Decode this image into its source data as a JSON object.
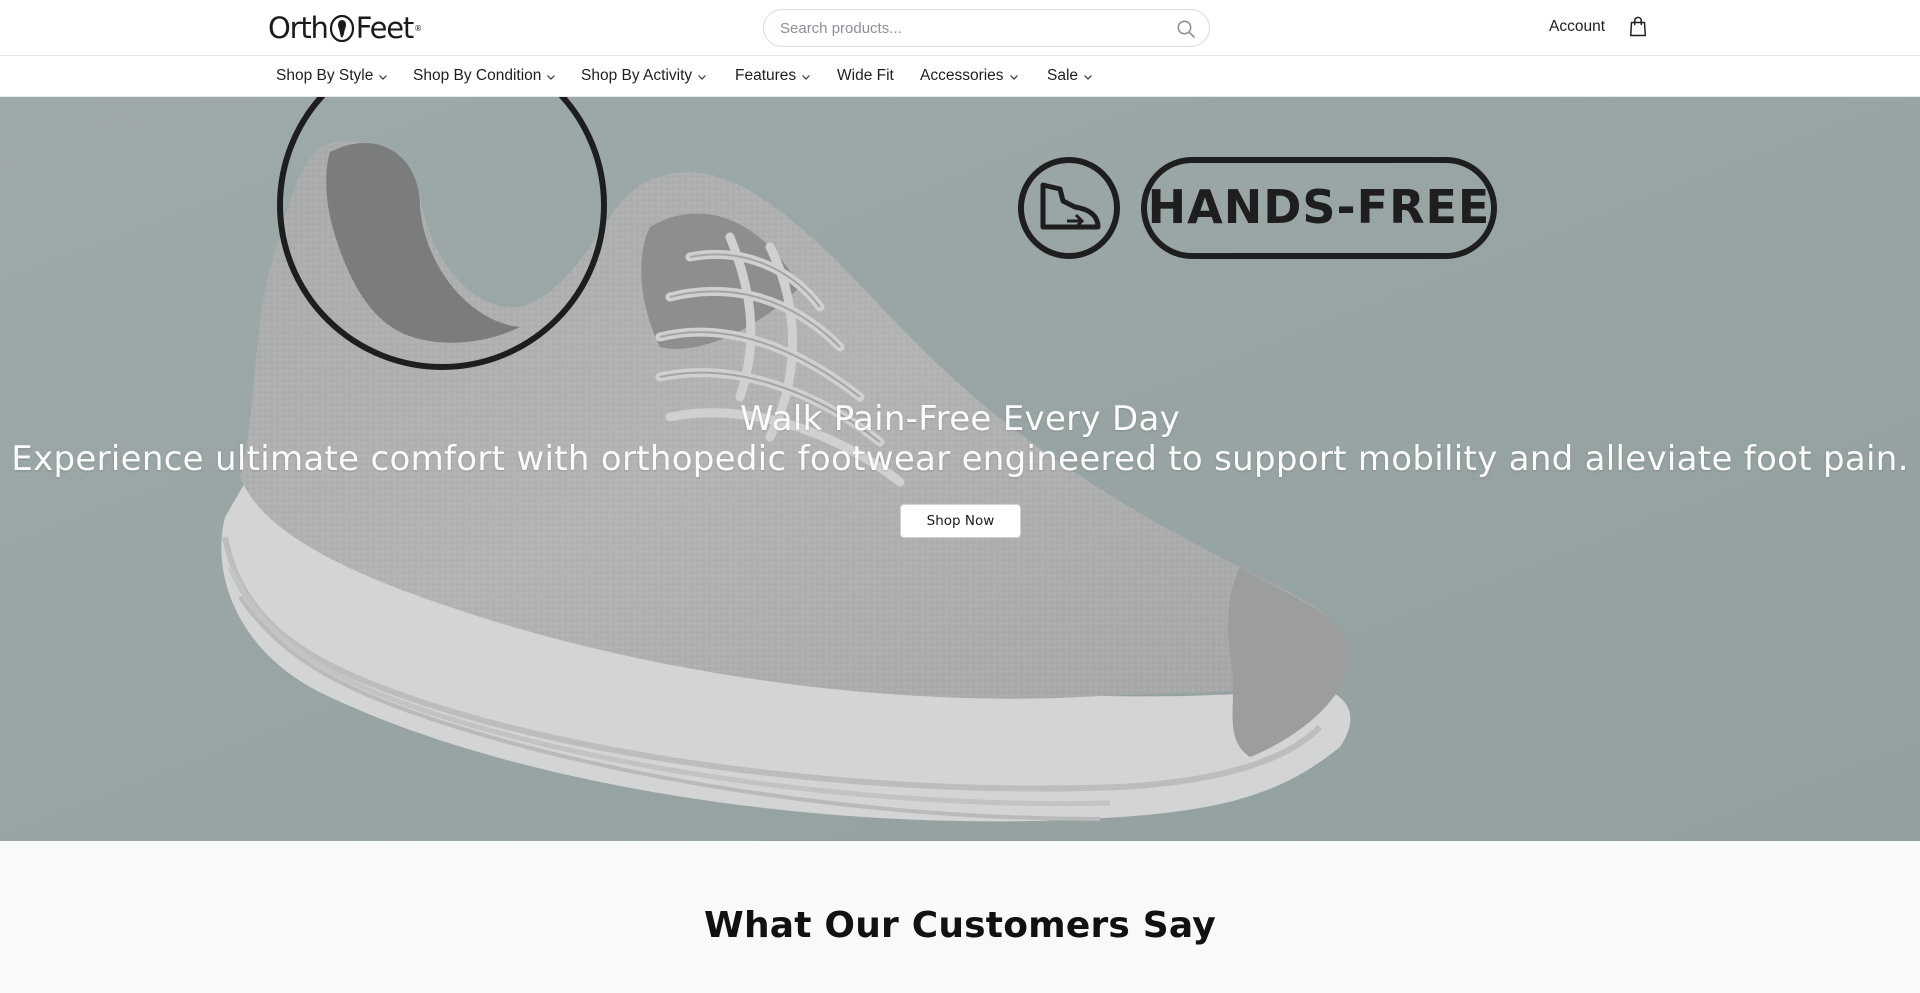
{
  "header": {
    "logo_text_left": "Orth",
    "logo_text_right": "Feet",
    "logo_reg": "®",
    "search_placeholder": "Search products...",
    "account_label": "Account"
  },
  "nav": {
    "items": [
      {
        "label": "Shop By Style",
        "has_dropdown": true
      },
      {
        "label": "Shop By Condition",
        "has_dropdown": true
      },
      {
        "label": "Shop By Activity",
        "has_dropdown": true
      },
      {
        "label": "Features",
        "has_dropdown": true
      },
      {
        "label": "Wide Fit",
        "has_dropdown": false
      },
      {
        "label": "Accessories",
        "has_dropdown": true
      },
      {
        "label": "Sale",
        "has_dropdown": true
      }
    ]
  },
  "hero": {
    "title": "Walk Pain-Free Every Day",
    "subtitle": "Experience ultimate comfort with orthopedic footwear engineered to support mobility and alleviate foot pain.",
    "cta_label": "Shop Now",
    "badge_text": "HANDS-FREE"
  },
  "testimonials": {
    "title": "What Our Customers Say"
  },
  "colors": {
    "hero_bg": "#9aa6a6",
    "shoe_gray": "#b4b6b6",
    "page_bg": "#f8f9fb"
  }
}
